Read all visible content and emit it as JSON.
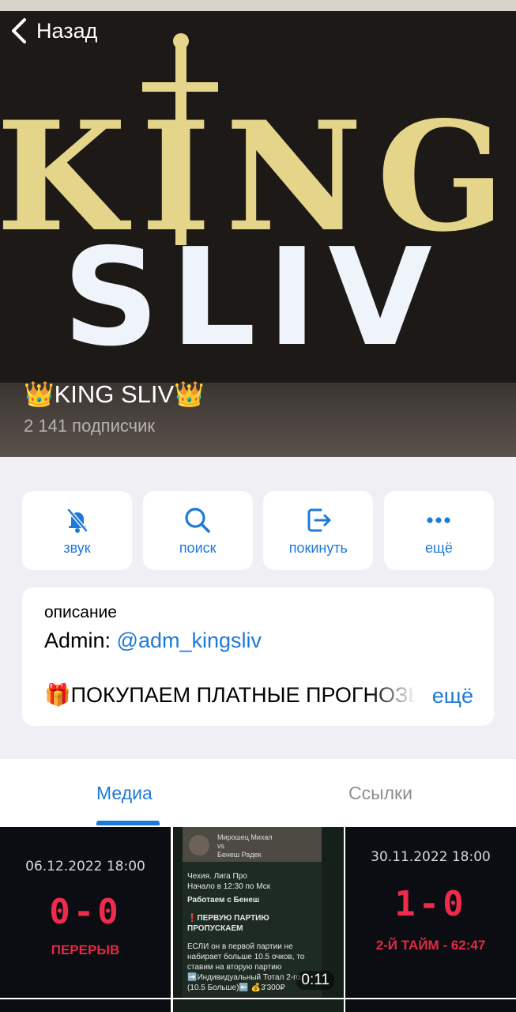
{
  "nav": {
    "back_label": "Назад"
  },
  "channel": {
    "name": "👑KING SLIV👑",
    "subscribers": "2 141 подписчик",
    "logo_line1": "KING",
    "logo_line2": "SLIV"
  },
  "actions": [
    {
      "label": "звук",
      "icon": "bell-slash-icon"
    },
    {
      "label": "поиск",
      "icon": "search-icon"
    },
    {
      "label": "покинуть",
      "icon": "leave-icon"
    },
    {
      "label": "ещё",
      "icon": "more-icon"
    }
  ],
  "description": {
    "label": "описание",
    "admin_prefix": "Admin: ",
    "admin_link": "@adm_kingsliv",
    "text": "🎁ПОКУПАЕМ ПЛАТНЫЕ ПРОГНОЗЫ",
    "more": "ещё"
  },
  "tabs": {
    "media": "Медиа",
    "links": "Ссылки"
  },
  "media": [
    {
      "date": "06.12.2022 18:00",
      "score": "0-0",
      "status": "ПЕРЕРЫВ"
    },
    {
      "header": "Мирошец Михал\nvs\nБенеш Радек",
      "lines": [
        "Чехия. Лига Про",
        "Начало в 12:30 по Мск",
        "Работаем с Бенеш",
        "❗ПЕРВУЮ ПАРТИЮ ПРОПУСКАЕМ",
        "ЕСЛИ он в первой партии не набирает больше 10.5 очков, то ставим на вторую партию",
        "➡️Индивидуальный Тотал 2-го (10.5 Больше)⬅️ 💰3'300₽"
      ],
      "duration": "0:11"
    },
    {
      "date": "30.11.2022 18:00",
      "score": "1-0",
      "status": "2-Й ТАЙМ - 62:47"
    }
  ],
  "colors": {
    "accent": "#1e7ad8",
    "logo_gold": "#e5d58a",
    "logo_white": "#eef4fa",
    "score_red": "#ee2b4b"
  }
}
